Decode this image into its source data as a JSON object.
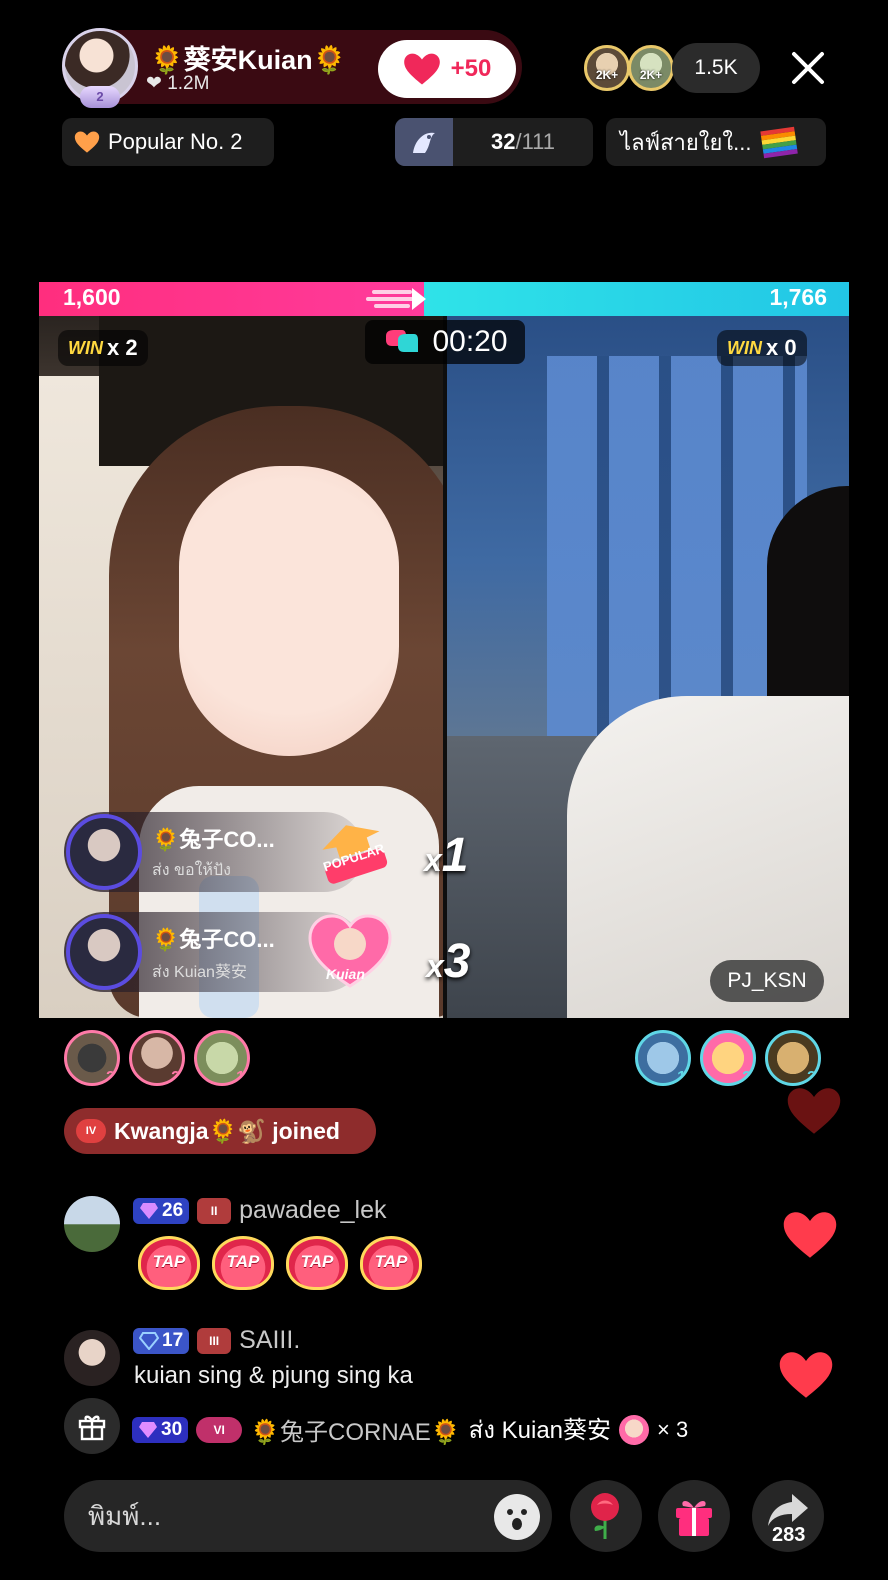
{
  "header": {
    "host_name": "🌻葵安Kuian🌻",
    "host_likes": "1.2M",
    "host_level": "2",
    "follow_label": "+50",
    "top_viewers": [
      {
        "label": "2K+",
        "icon": "viewer-avatar-icon"
      },
      {
        "label": "2K+",
        "icon": "viewer-avatar-icon"
      }
    ],
    "viewer_count": "1.5K",
    "close_icon": "close-icon"
  },
  "chips": {
    "popular": "Popular No. 2",
    "rank_current": "32",
    "rank_total": "/111",
    "live_title": "ไลฟ์สายใยใ..."
  },
  "battle": {
    "left_score": "1,600",
    "right_score": "1,766",
    "left_score_share": 0.475,
    "left_wins_label": "WIN",
    "left_wins": "x 2",
    "right_wins_label": "WIN",
    "right_wins": "x 0",
    "timer": "00:20",
    "opponent_name": "PJ_KSN"
  },
  "gifts": [
    {
      "user": "🌻兔子CO...",
      "sub": "ส่ง ขอให้ปัง",
      "gift_label": "POPULAR",
      "multiplier": "x",
      "count": "1"
    },
    {
      "user": "🌻兔子CO...",
      "sub": "ส่ง Kuian葵安",
      "gift_label": "Kuian",
      "multiplier": "x",
      "count": "3"
    }
  ],
  "supporters_left": [
    {
      "rank": "3"
    },
    {
      "rank": "2"
    },
    {
      "rank": "1"
    }
  ],
  "supporters_right": [
    {
      "rank": "1"
    },
    {
      "rank": "2"
    },
    {
      "rank": "3"
    }
  ],
  "joined": {
    "level": "IV",
    "text": "Kwangja🌻🐒 joined"
  },
  "comments": [
    {
      "level": "26",
      "badge": "II",
      "user": "pawadee_lek",
      "text": "",
      "taps": [
        "TAP",
        "TAP",
        "TAP",
        "TAP"
      ]
    },
    {
      "level": "17",
      "badge": "III",
      "user": "SAIII.",
      "text": "kuian sing & pjung sing ka"
    }
  ],
  "gift_notice": {
    "level": "30",
    "badge": "VI",
    "user": "🌻兔子CORNAE🌻",
    "action": "ส่ง Kuian葵安",
    "count": "× 3"
  },
  "bottom": {
    "input_placeholder": "พิมพ์...",
    "share_count": "283"
  },
  "colors": {
    "accent_pink": "#ff2e7e",
    "accent_cyan": "#2fe3e8",
    "like_red": "#f0285a"
  }
}
